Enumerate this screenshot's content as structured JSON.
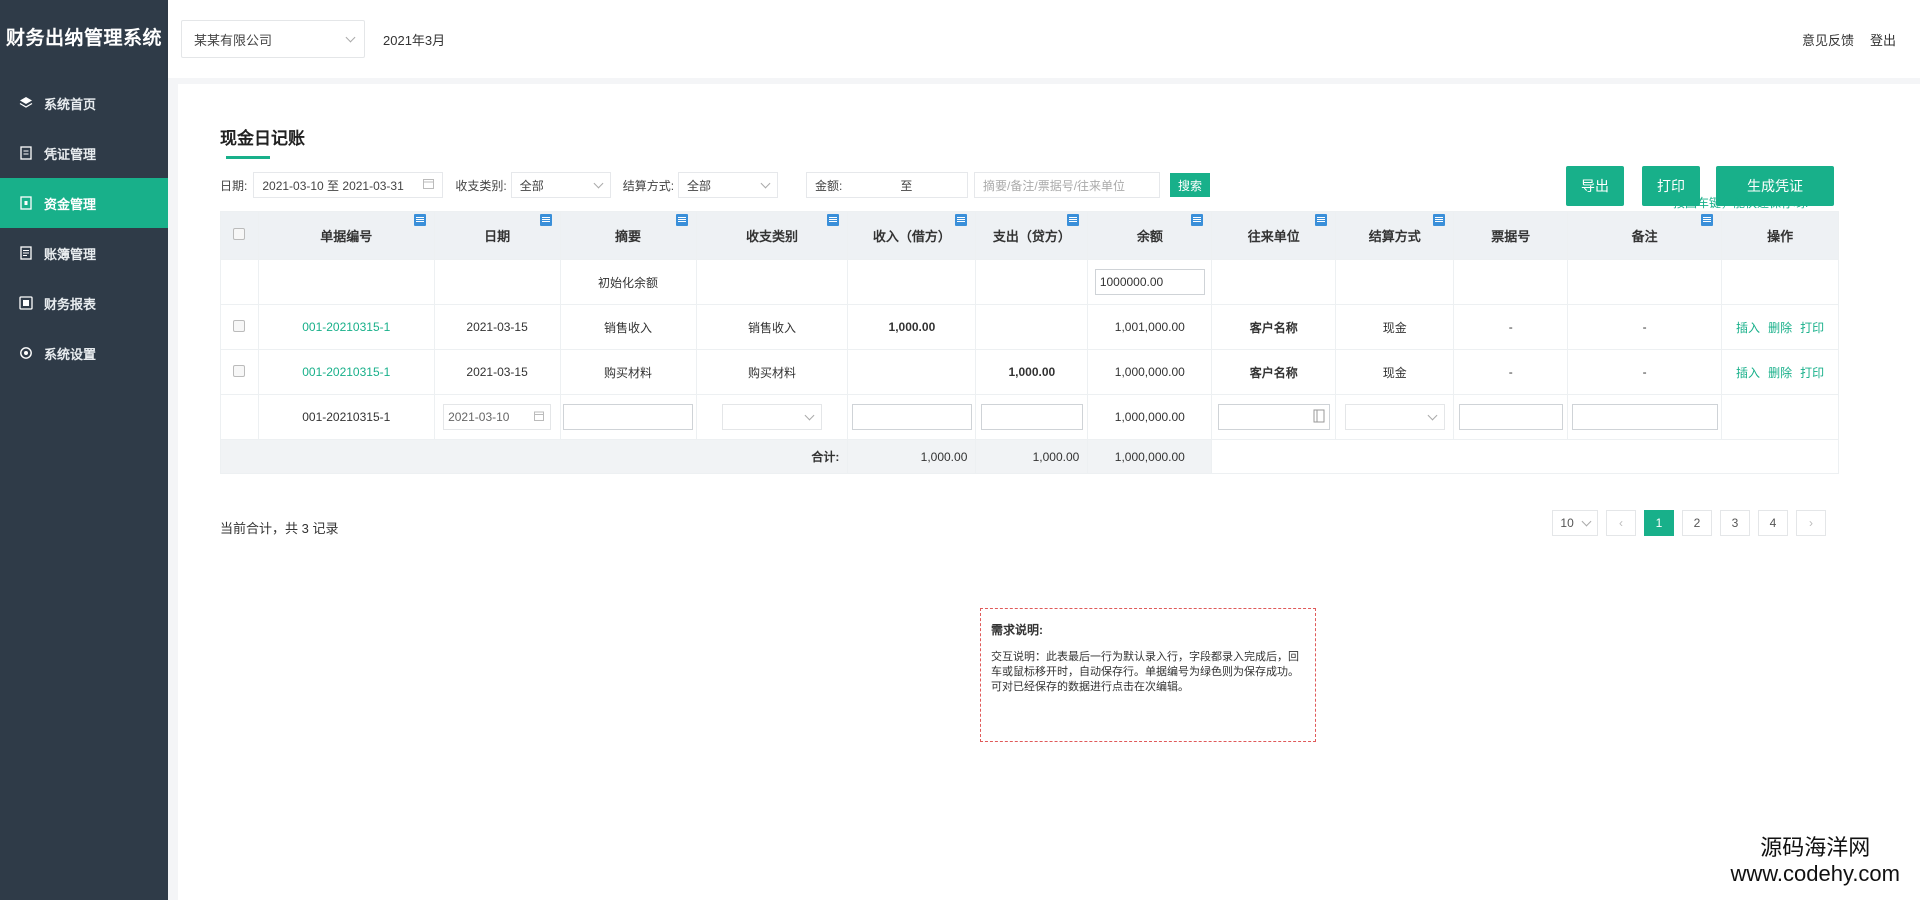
{
  "sidebar": {
    "brand": "财务出纳管理系统",
    "items": [
      {
        "label": "系统首页",
        "icon": "layers-icon"
      },
      {
        "label": "凭证管理",
        "icon": "document-icon"
      },
      {
        "label": "资金管理",
        "icon": "wallet-icon"
      },
      {
        "label": "账簿管理",
        "icon": "ledger-icon"
      },
      {
        "label": "财务报表",
        "icon": "report-icon"
      },
      {
        "label": "系统设置",
        "icon": "gear-icon"
      }
    ],
    "active_index": 2
  },
  "header": {
    "company": "某某有限公司",
    "month": "2021年3月",
    "feedback": "意见反馈",
    "logout": "登出"
  },
  "page": {
    "title": "现金日记账"
  },
  "filters": {
    "date_label": "日期:",
    "date_range": "2021-03-10 至 2021-03-31",
    "type_label": "收支类别:",
    "type_value": "全部",
    "method_label": "结算方式:",
    "method_value": "全部",
    "amount_label": "金额:",
    "amount_to": "至",
    "keyword_placeholder": "摘要/备注/票据号/往来单位",
    "search": "搜索"
  },
  "actions": {
    "export": "导出",
    "print": "打印",
    "generate": "生成凭证",
    "hint": "按回车键，能快速保存哟!"
  },
  "table": {
    "headers": [
      "单据编号",
      "日期",
      "摘要",
      "收支类别",
      "收入（借方）",
      "支出（贷方）",
      "余额",
      "往来单位",
      "结算方式",
      "票据号",
      "备注",
      "操作"
    ],
    "init_row": {
      "summary": "初始化余额",
      "balance": "1000000.00"
    },
    "rows": [
      {
        "no": "001-20210315-1",
        "date": "2021-03-15",
        "summary": "销售收入",
        "category": "销售收入",
        "income": "1,000.00",
        "expense": "",
        "balance": "1,001,000.00",
        "party": "客户名称",
        "method": "现金",
        "ticket": "-",
        "remark": "-"
      },
      {
        "no": "001-20210315-1",
        "date": "2021-03-15",
        "summary": "购买材料",
        "category": "购买材料",
        "income": "",
        "expense": "1,000.00",
        "balance": "1,000,000.00",
        "party": "客户名称",
        "method": "现金",
        "ticket": "-",
        "remark": "-"
      }
    ],
    "row_ops": {
      "insert": "插入",
      "delete": "删除",
      "print": "打印"
    },
    "new_row": {
      "no": "001-20210315-1",
      "date": "2021-03-10",
      "balance": "1,000,000.00"
    },
    "sum": {
      "label": "合计:",
      "income": "1,000.00",
      "expense": "1,000.00",
      "balance": "1,000,000.00"
    }
  },
  "footer": {
    "total_text": "当前合计，共 3 记录"
  },
  "pagination": {
    "page_size": "10",
    "pages": [
      "1",
      "2",
      "3",
      "4"
    ],
    "current": "1"
  },
  "note": {
    "title": "需求说明:",
    "body": "交互说明：此表最后一行为默认录入行，字段都录入完成后，回车或鼠标移开时，自动保存行。单据编号为绿色则为保存成功。",
    "body2": "可对已经保存的数据进行点击在次编辑。"
  },
  "watermark": {
    "line1": "源码海洋网",
    "line2": "www.codehy.com"
  },
  "colors": {
    "accent": "#18b08a",
    "sidebar_bg": "#2f3b48"
  }
}
